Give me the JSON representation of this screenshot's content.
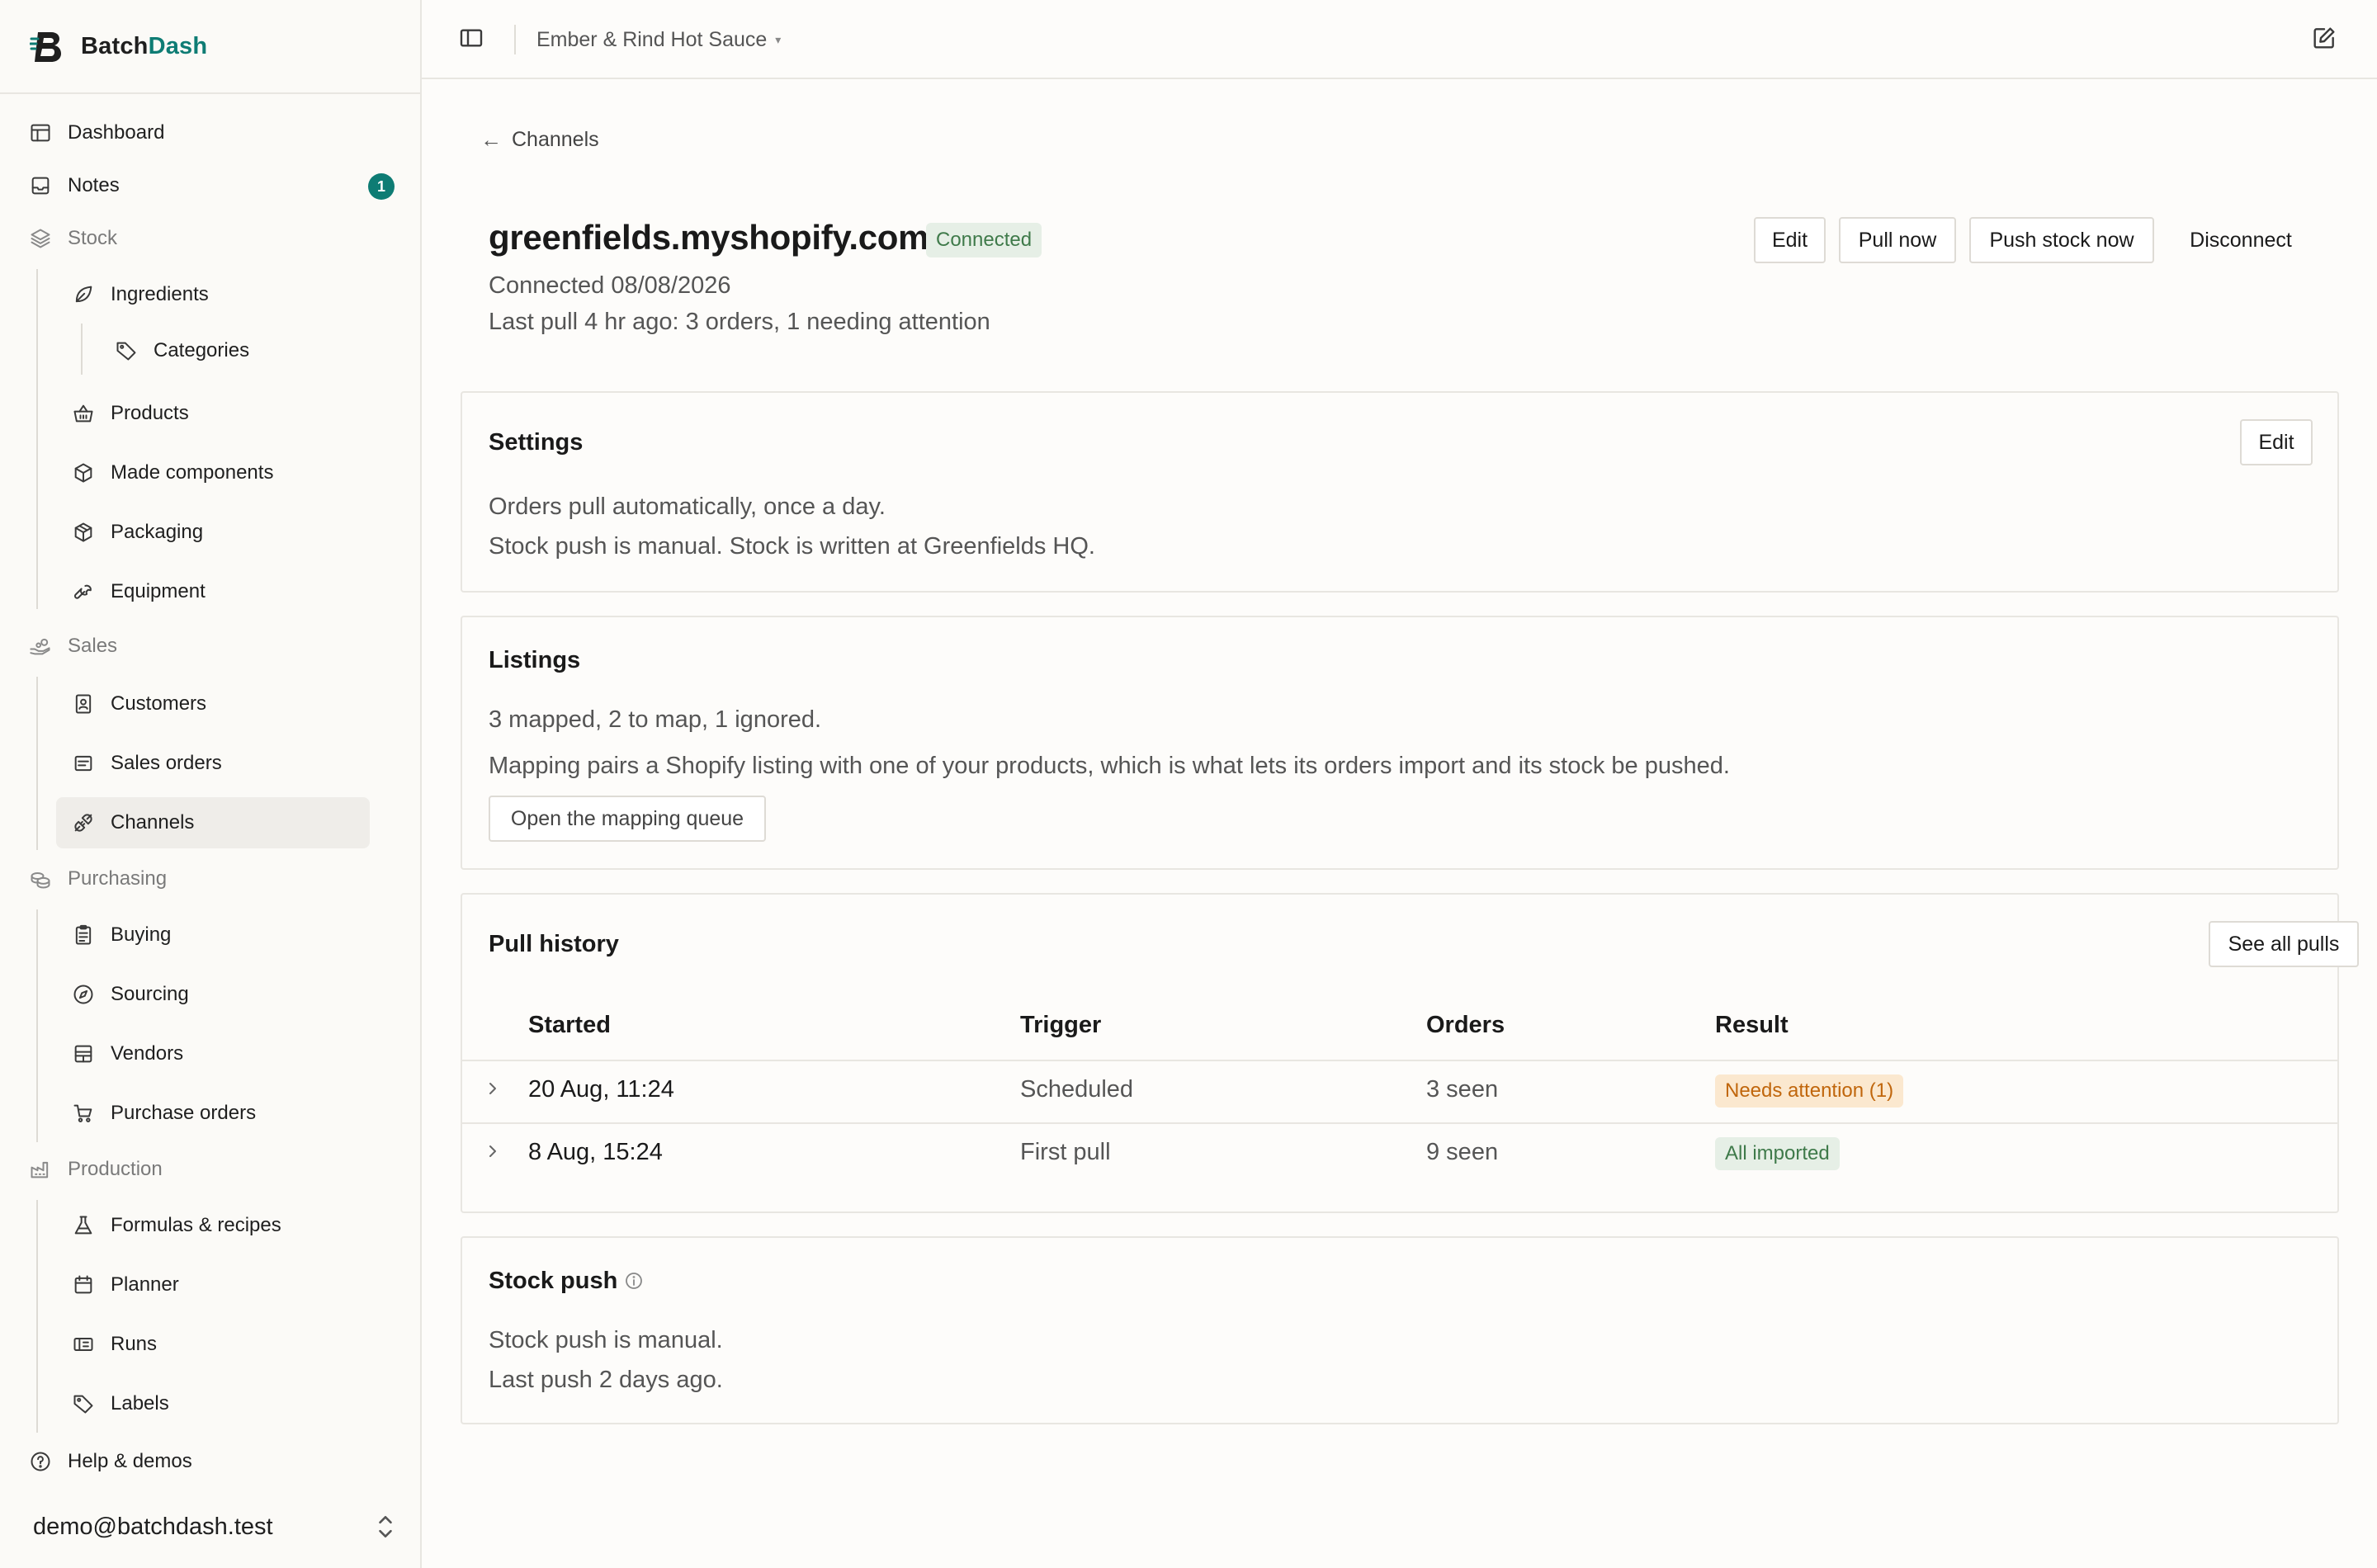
{
  "brand": {
    "name_prefix": "Batch",
    "name_accent": "Dash",
    "accent_color": "#0e7c74"
  },
  "sidebar": {
    "dashboard": "Dashboard",
    "notes": "Notes",
    "notes_badge": "1",
    "stock": "Stock",
    "ingredients": "Ingredients",
    "categories": "Categories",
    "products": "Products",
    "made_components": "Made components",
    "packaging": "Packaging",
    "equipment": "Equipment",
    "sales": "Sales",
    "customers": "Customers",
    "sales_orders": "Sales orders",
    "channels": "Channels",
    "purchasing": "Purchasing",
    "buying": "Buying",
    "sourcing": "Sourcing",
    "vendors": "Vendors",
    "purchase_orders": "Purchase orders",
    "production": "Production",
    "formulas": "Formulas & recipes",
    "planner": "Planner",
    "runs": "Runs",
    "labels": "Labels",
    "help": "Help & demos",
    "user_email": "demo@batchdash.test"
  },
  "topbar": {
    "org_name": "Ember & Rind Hot Sauce",
    "org_caret": "▾"
  },
  "page": {
    "back_label": "Channels",
    "title": "greenfields.myshopify.com",
    "status": "Connected",
    "connected_date": "Connected 08/08/2026",
    "last_pull": "Last pull 4 hr ago: 3 orders, 1 needing attention",
    "actions": {
      "edit": "Edit",
      "pull_now": "Pull now",
      "push_stock_now": "Push stock now",
      "disconnect": "Disconnect"
    }
  },
  "settings": {
    "title": "Settings",
    "edit": "Edit",
    "line1": "Orders pull automatically, once a day.",
    "line2": "Stock push is manual. Stock is written at Greenfields HQ."
  },
  "listings": {
    "title": "Listings",
    "summary": "3 mapped, 2 to map, 1 ignored.",
    "description": "Mapping pairs a Shopify listing with one of your products, which is what lets its orders import and its stock be pushed.",
    "queue_button": "Open the mapping queue"
  },
  "pull_history": {
    "title": "Pull history",
    "see_all": "See all pulls",
    "columns": [
      "Started",
      "Trigger",
      "Orders",
      "Result"
    ],
    "rows": [
      {
        "started": "20 Aug, 11:24",
        "trigger": "Scheduled",
        "orders": "3 seen",
        "result": "Needs attention (1)",
        "result_type": "warning"
      },
      {
        "started": "8 Aug, 15:24",
        "trigger": "First pull",
        "orders": "9 seen",
        "result": "All imported",
        "result_type": "success"
      }
    ]
  },
  "stock_push": {
    "title": "Stock push",
    "line1": "Stock push is manual.",
    "line2": "Last push 2 days ago."
  }
}
